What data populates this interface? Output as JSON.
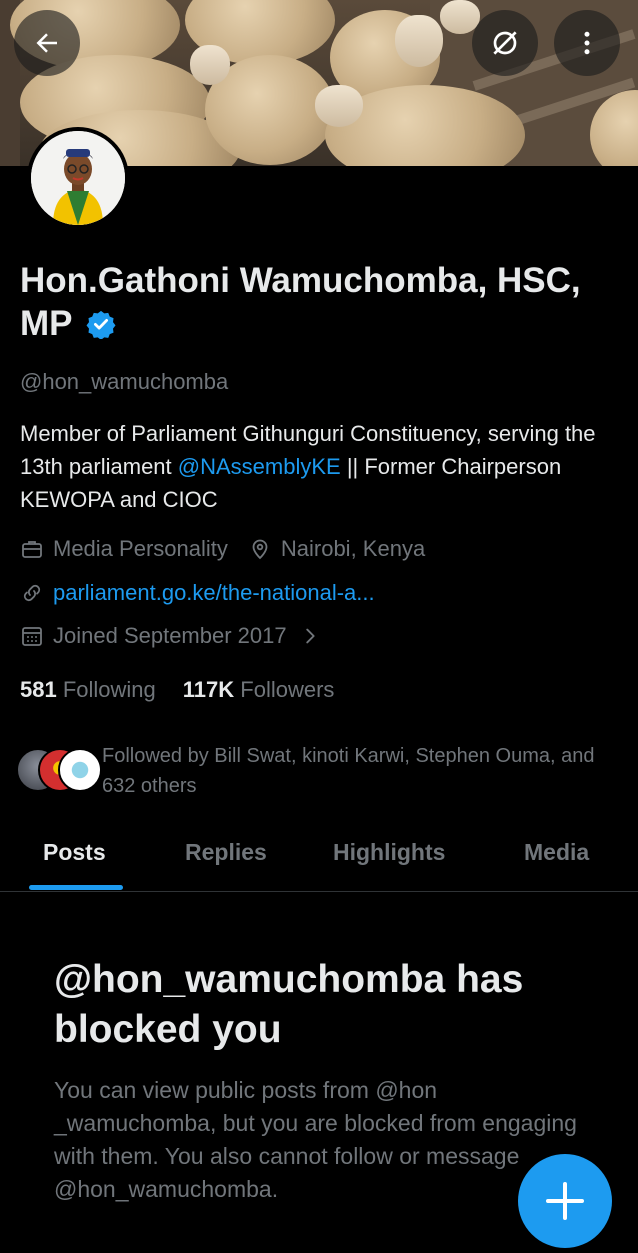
{
  "profile": {
    "name": "Hon.Gathoni Wamuchomba, HSC, MP",
    "handle": "@hon_wamuchomba",
    "bio_part1": "Member of Parliament Githunguri Constituency, serving the 13th parliament ",
    "bio_mention": "@NAssemblyKE",
    "bio_part2": " || Former Chairperson KEWOPA and CIOC",
    "category": "Media Personality",
    "location": "Nairobi, Kenya",
    "website": "parliament.go.ke/the-national-a...",
    "joined": "Joined September 2017"
  },
  "stats": {
    "following_count": "581",
    "following_label": "Following",
    "followers_count": "117K",
    "followers_label": "Followers"
  },
  "followed_by": "Followed by Bill Swat, kinoti Karwi, Stephen Ouma, and 632 others",
  "tabs": [
    "Posts",
    "Replies",
    "Highlights",
    "Media"
  ],
  "active_tab": "Posts",
  "blocked": {
    "title": "@hon_wamuchomba has blocked you",
    "body": "You can view public posts from @hon _wamuchomba, but you are blocked from engaging with them. You also cannot follow or message @hon_wamuchomba."
  },
  "icons": {
    "back": "back-arrow-icon",
    "disconnected": "crossed-circle-icon",
    "more": "more-vertical-icon",
    "verified": "verified-badge-icon",
    "category": "briefcase-icon",
    "location": "location-pin-icon",
    "website": "link-icon",
    "joined": "calendar-icon",
    "compose": "compose-plus-icon"
  },
  "colors": {
    "accent": "#1d9bf0",
    "background": "#000000",
    "primary_text": "#e7e9ea",
    "secondary_text": "#71767b"
  }
}
